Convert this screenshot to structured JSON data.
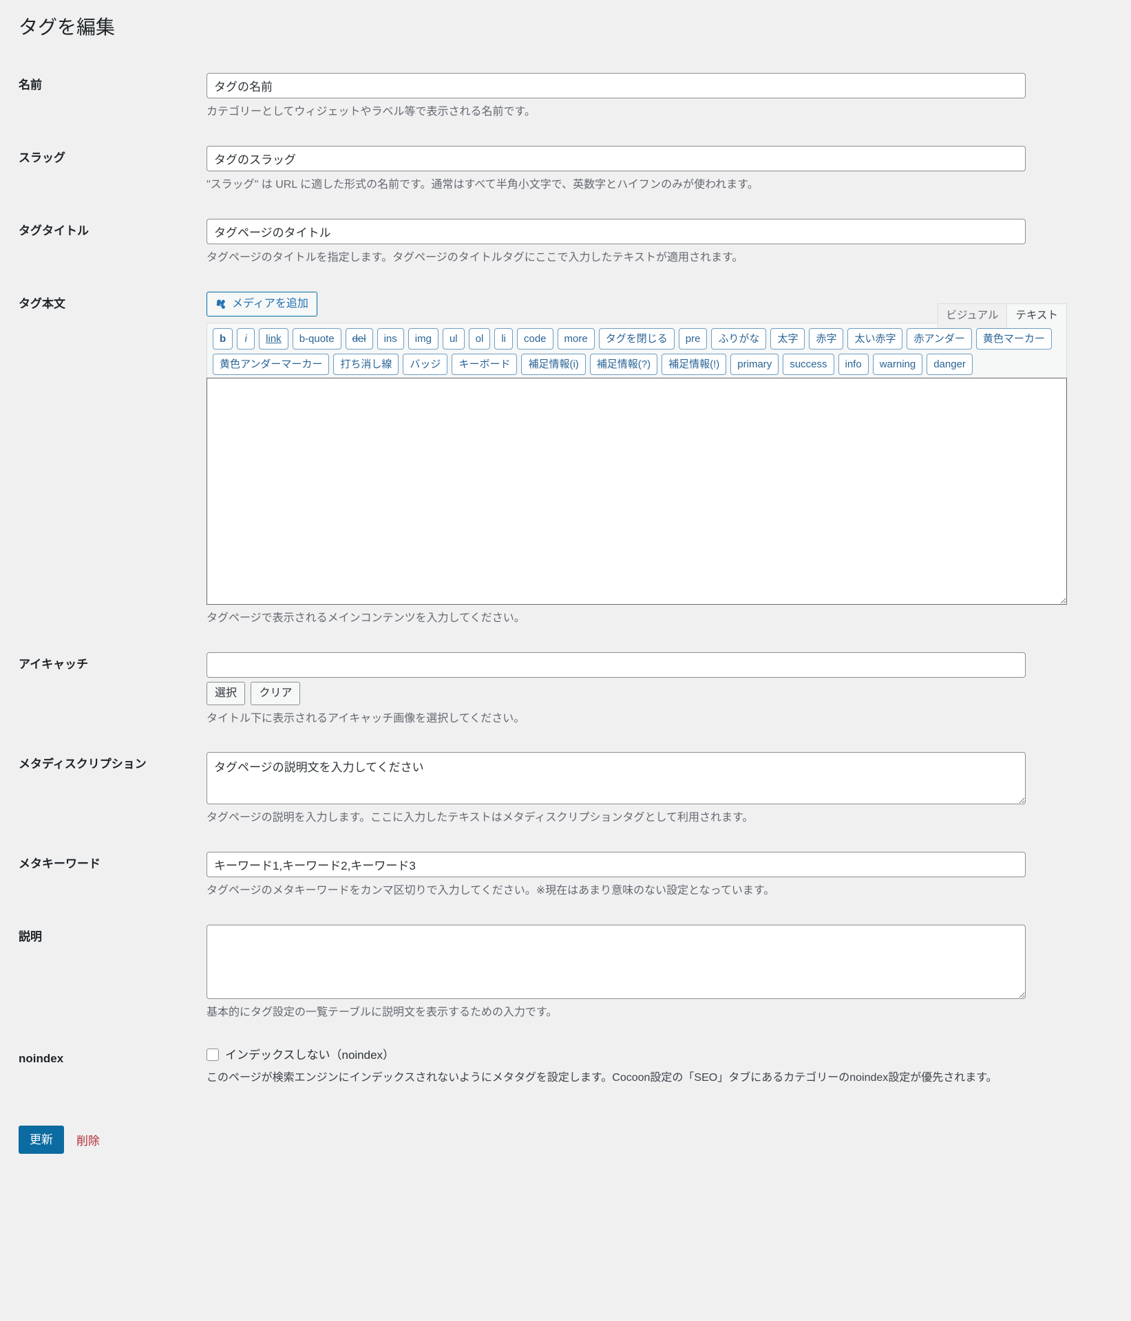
{
  "page": {
    "title": "タグを編集"
  },
  "fields": {
    "name": {
      "label": "名前",
      "value": "タグの名前",
      "description": "カテゴリーとしてウィジェットやラベル等で表示される名前です。"
    },
    "slug": {
      "label": "スラッグ",
      "value": "タグのスラッグ",
      "description": "\"スラッグ\" は URL に適した形式の名前です。通常はすべて半角小文字で、英数字とハイフンのみが使われます。"
    },
    "tag_title": {
      "label": "タグタイトル",
      "value": "タグページのタイトル",
      "description": "タグページのタイトルを指定します。タグページのタイトルタグにここで入力したテキストが適用されます。"
    },
    "tag_body": {
      "label": "タグ本文",
      "value": "",
      "description": "タグページで表示されるメインコンテンツを入力してください。"
    },
    "eyecatch": {
      "label": "アイキャッチ",
      "value": "",
      "select_label": "選択",
      "clear_label": "クリア",
      "description": "タイトル下に表示されるアイキャッチ画像を選択してください。"
    },
    "meta_description": {
      "label": "メタディスクリプション",
      "value": "タグページの説明文を入力してください",
      "description": "タグページの説明を入力します。ここに入力したテキストはメタディスクリプションタグとして利用されます。"
    },
    "meta_keywords": {
      "label": "メタキーワード",
      "value": "キーワード1,キーワード2,キーワード3",
      "description": "タグページのメタキーワードをカンマ区切りで入力してください。※現在はあまり意味のない設定となっています。"
    },
    "description": {
      "label": "説明",
      "value": "",
      "description": "基本的にタグ設定の一覧テーブルに説明文を表示するための入力です。"
    },
    "noindex": {
      "label": "noindex",
      "checkbox_label": "インデックスしない（noindex）",
      "checked": false,
      "description": "このページが検索エンジンにインデックスされないようにメタタグを設定します。Cocoon設定の「SEO」タブにあるカテゴリーのnoindex設定が優先されます。"
    }
  },
  "editor": {
    "add_media_label": "メディアを追加",
    "add_media_icon": "media-icon",
    "tabs": [
      {
        "label": "ビジュアル",
        "active": false
      },
      {
        "label": "テキスト",
        "active": true
      }
    ],
    "quicktags": [
      {
        "label": "b",
        "style": "qt-b"
      },
      {
        "label": "i",
        "style": "qt-i"
      },
      {
        "label": "link",
        "style": "qt-link"
      },
      {
        "label": "b-quote",
        "style": ""
      },
      {
        "label": "del",
        "style": "qt-del"
      },
      {
        "label": "ins",
        "style": ""
      },
      {
        "label": "img",
        "style": ""
      },
      {
        "label": "ul",
        "style": ""
      },
      {
        "label": "ol",
        "style": ""
      },
      {
        "label": "li",
        "style": ""
      },
      {
        "label": "code",
        "style": ""
      },
      {
        "label": "more",
        "style": ""
      },
      {
        "label": "タグを閉じる",
        "style": ""
      },
      {
        "label": "pre",
        "style": ""
      },
      {
        "label": "ふりがな",
        "style": ""
      },
      {
        "label": "太字",
        "style": ""
      },
      {
        "label": "赤字",
        "style": ""
      },
      {
        "label": "太い赤字",
        "style": ""
      },
      {
        "label": "赤アンダー",
        "style": ""
      },
      {
        "label": "黄色マーカー",
        "style": ""
      },
      {
        "label": "黄色アンダーマーカー",
        "style": ""
      },
      {
        "label": "打ち消し線",
        "style": ""
      },
      {
        "label": "バッジ",
        "style": ""
      },
      {
        "label": "キーボード",
        "style": ""
      },
      {
        "label": "補足情報(i)",
        "style": ""
      },
      {
        "label": "補足情報(?)",
        "style": ""
      },
      {
        "label": "補足情報(!)",
        "style": ""
      },
      {
        "label": "primary",
        "style": ""
      },
      {
        "label": "success",
        "style": ""
      },
      {
        "label": "info",
        "style": ""
      },
      {
        "label": "warning",
        "style": ""
      },
      {
        "label": "danger",
        "style": ""
      }
    ]
  },
  "footer": {
    "update_label": "更新",
    "delete_label": "削除"
  },
  "colors": {
    "background": "#f0f0f1",
    "primary_button": "#0c6ba1",
    "delete_link": "#b32d2e",
    "quicktag_border": "#6e9ec4",
    "quicktag_text": "#2a6496",
    "media_link": "#2271b1"
  }
}
